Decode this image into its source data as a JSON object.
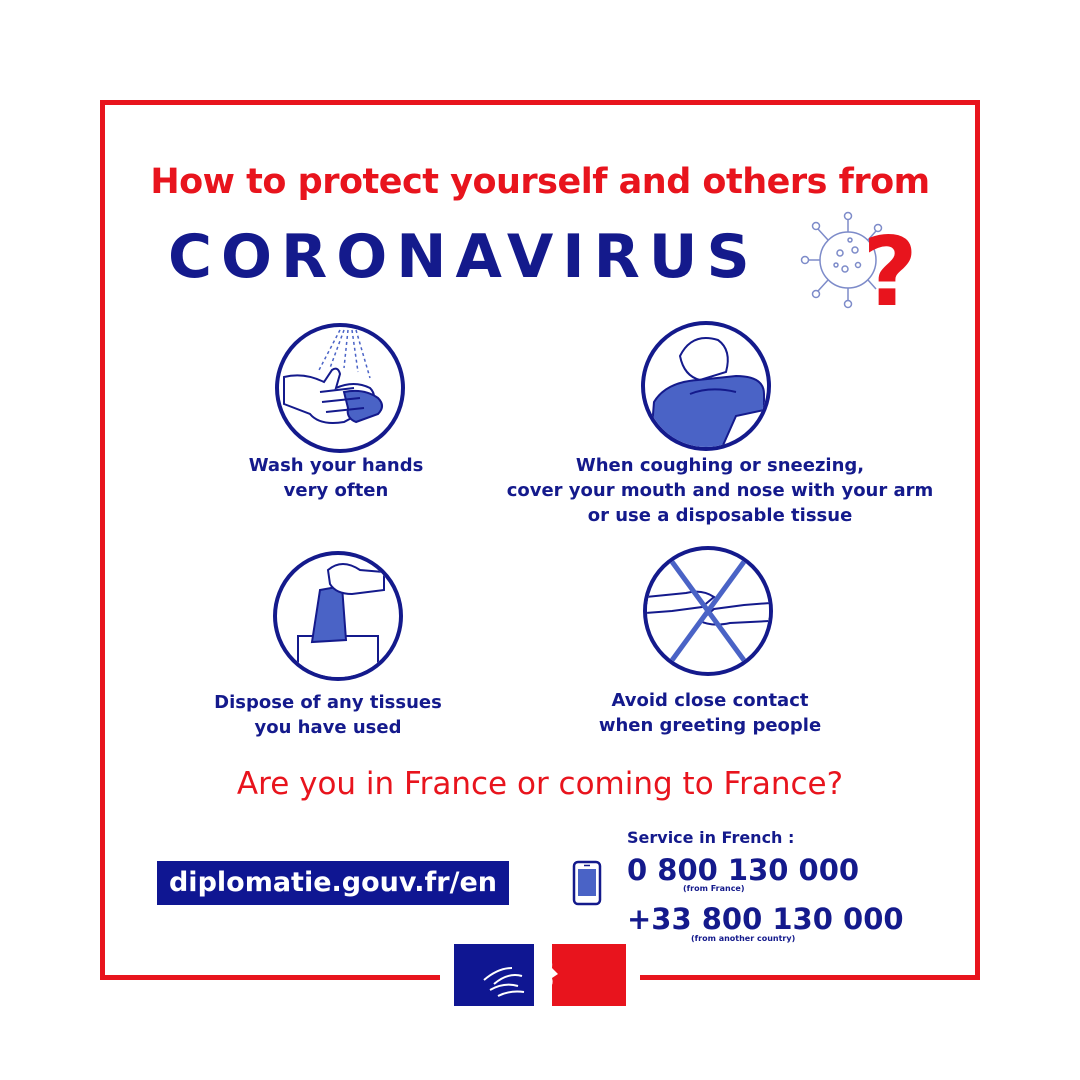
{
  "header": {
    "title": "How to protect yourself and others from",
    "disease": "CORONAVIRUS",
    "virus_icon": "virus-question-icon"
  },
  "tips": [
    {
      "icon": "handwashing-icon",
      "line1": "Wash your hands",
      "line2": "very often"
    },
    {
      "icon": "cough-into-elbow-icon",
      "line1": "When coughing or sneezing,",
      "line2": "cover your mouth and nose with your arm",
      "line3": "or use a disposable tissue"
    },
    {
      "icon": "tissue-disposal-icon",
      "line1": "Dispose of any tissues",
      "line2": "you have used"
    },
    {
      "icon": "no-handshake-icon",
      "line1": "Avoid close contact",
      "line2": "when greeting people"
    }
  ],
  "footer": {
    "question": "Are you in France or coming to France?",
    "website": "diplomatie.gouv.fr/en",
    "service_label": "Service in French :",
    "phone_france": "0 800 130 000",
    "phone_france_note": "(from France)",
    "phone_abroad": "+33 800 130 000",
    "phone_abroad_note": "(from another country)",
    "logo": "marianne-logo"
  },
  "colors": {
    "red": "#e8141d",
    "navy": "#141a8c",
    "icon_blue": "#4a63c6"
  }
}
